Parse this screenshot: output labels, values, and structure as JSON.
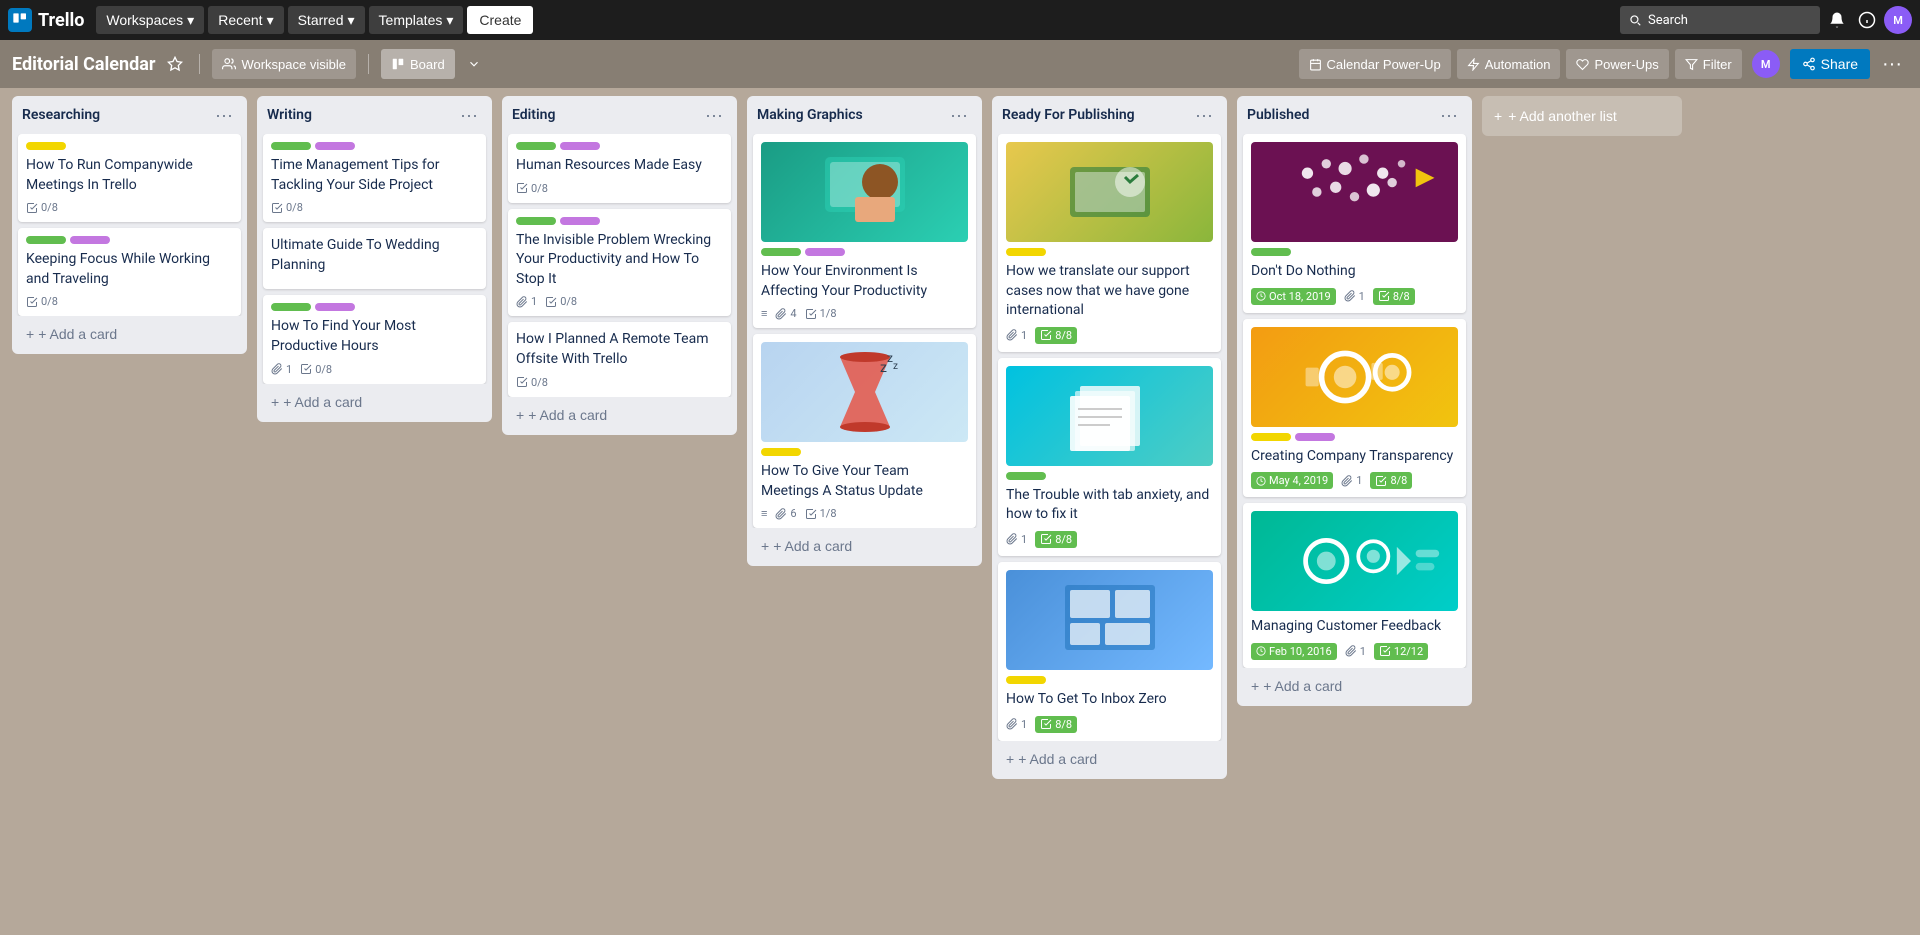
{
  "topNav": {
    "logo": "Trello",
    "workspaces": "Workspaces",
    "recent": "Recent",
    "starred": "Starred",
    "templates": "Templates",
    "create": "Create",
    "search": "Search",
    "chevron": "▾"
  },
  "boardHeader": {
    "title": "Editorial Calendar",
    "workspaceVisible": "Workspace visible",
    "board": "Board",
    "calendarPowerUp": "Calendar Power-Up",
    "automation": "Automation",
    "powerUps": "Power-Ups",
    "filter": "Filter",
    "share": "Share",
    "ellipsis": "···"
  },
  "lists": [
    {
      "id": "researching",
      "title": "Researching",
      "cards": [
        {
          "id": "r1",
          "labels": [
            "yellow"
          ],
          "title": "How To Run Companywide Meetings In Trello",
          "checklist": "0/8",
          "hasAttachment": false
        },
        {
          "id": "r2",
          "labels": [
            "green",
            "purple"
          ],
          "title": "Keeping Focus While Working and Traveling",
          "checklist": "0/8",
          "hasAttachment": false
        }
      ],
      "addCardLabel": "+ Add a card"
    },
    {
      "id": "writing",
      "title": "Writing",
      "cards": [
        {
          "id": "w1",
          "labels": [
            "green",
            "purple"
          ],
          "title": "Time Management Tips for Tackling Your Side Project",
          "checklist": "0/8",
          "hasAttachment": false
        },
        {
          "id": "w2",
          "labels": [],
          "title": "Ultimate Guide To Wedding Planning",
          "checklist": null,
          "hasAttachment": false
        },
        {
          "id": "w3",
          "labels": [
            "green",
            "purple"
          ],
          "title": "How To Find Your Most Productive Hours",
          "checklist": "0/8",
          "attachmentCount": 1
        }
      ],
      "addCardLabel": "+ Add a card"
    },
    {
      "id": "editing",
      "title": "Editing",
      "cards": [
        {
          "id": "e1",
          "labels": [
            "green",
            "purple"
          ],
          "title": "Human Resources Made Easy",
          "checklist": "0/8",
          "hasAttachment": false
        },
        {
          "id": "e2",
          "labels": [
            "green",
            "purple"
          ],
          "title": "The Invisible Problem Wrecking Your Productivity and How To Stop It",
          "checklist": "0/8",
          "attachmentCount": 1
        },
        {
          "id": "e3",
          "labels": [],
          "title": "How I Planned A Remote Team Offsite With Trello",
          "checklist": "0/8",
          "hasAttachment": false
        }
      ],
      "addCardLabel": "+ Add a card"
    },
    {
      "id": "making-graphics",
      "title": "Making Graphics",
      "cards": [
        {
          "id": "mg1",
          "image": "person-laptop",
          "labels": [
            "green",
            "purple"
          ],
          "title": "How Your Environment Is Affecting Your Productivity",
          "icons": "≡",
          "attachmentCount": 4,
          "checklist": "1/8"
        },
        {
          "id": "mg2",
          "image": "hourglass",
          "labels": [
            "yellow"
          ],
          "title": "How To Give Your Team Meetings A Status Update",
          "icons": "≡",
          "attachmentCount": 6,
          "checklist": "1/8"
        }
      ],
      "addCardLabel": "+ Add a card"
    },
    {
      "id": "ready-publishing",
      "title": "Ready For Publishing",
      "cards": [
        {
          "id": "rp1",
          "image": "laptop-shield",
          "labels": [
            "yellow"
          ],
          "title": "How we translate our support cases now that we have gone international",
          "attachmentCount": 1,
          "checklist": "8/8",
          "checklistComplete": true
        },
        {
          "id": "rp2",
          "image": "papers",
          "labels": [
            "green"
          ],
          "title": "The Trouble with tab anxiety, and how to fix it",
          "attachmentCount": 1,
          "checklist": "8/8",
          "checklistComplete": true
        },
        {
          "id": "rp3",
          "image": "windows-blue",
          "labels": [
            "yellow"
          ],
          "title": "How To Get To Inbox Zero",
          "attachmentCount": 1,
          "checklist": "8/8",
          "checklistComplete": true
        }
      ],
      "addCardLabel": "+ Add a card"
    },
    {
      "id": "published",
      "title": "Published",
      "cards": [
        {
          "id": "pub1",
          "image": "fish-purple",
          "labels": [
            "green"
          ],
          "title": "Don't Do Nothing",
          "date": "Oct 18, 2019",
          "attachmentCount": 1,
          "checklist": "8/8",
          "checklistComplete": true
        },
        {
          "id": "pub2",
          "image": "gears-yellow",
          "labels": [
            "yellow",
            "purple"
          ],
          "title": "Creating Company Transparency",
          "date": "May 4, 2019",
          "attachmentCount": 1,
          "checklist": "8/8",
          "checklistComplete": true
        },
        {
          "id": "pub3",
          "image": "gears-teal",
          "labels": [],
          "title": "Managing Customer Feedback",
          "date": "Feb 10, 2016",
          "attachmentCount": 1,
          "checklist": "12/12",
          "checklistComplete": true
        }
      ],
      "addCardLabel": "+ Add a card"
    }
  ],
  "addAnotherList": "+ Add another list"
}
